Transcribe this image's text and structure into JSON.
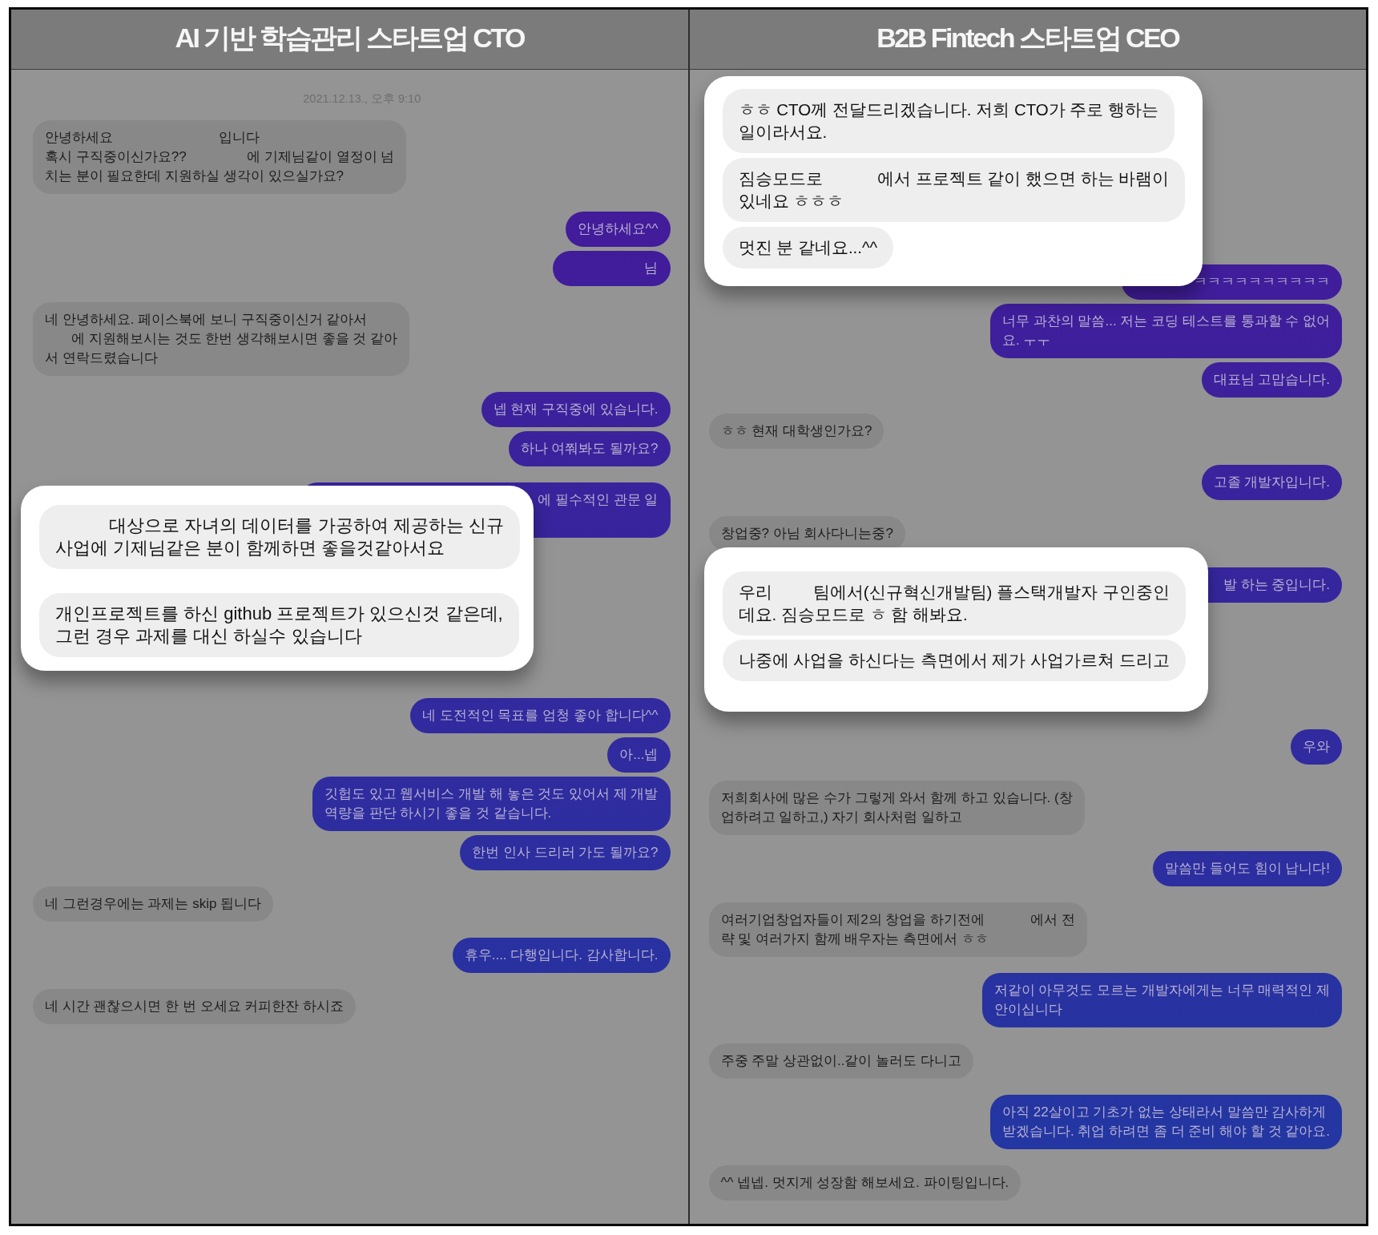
{
  "panels": [
    {
      "title": "AI 기반 학습관리 스타트업 CTO",
      "chat": [
        {
          "kind": "timestamp",
          "text": "2021.12.13., 오후 9:10"
        },
        {
          "kind": "received",
          "text": "안녕하세요                            입니다\n혹시 구직중이신가요??                에 기제님같이 열정이 넘\n치는 분이 필요한데 지원하실 생각이 있으실가요?"
        },
        {
          "kind": "sent",
          "text": "안녕하세요^^"
        },
        {
          "kind": "sent",
          "text": "                     님"
        },
        {
          "kind": "received",
          "text": "네 안녕하세요. 페이스북에 보니 구직중이신거 같아서\n       에 지원해보시는 것도 한번 생각해보시면 좋을 것 같아\n서 연락드렸습니다"
        },
        {
          "kind": "sent",
          "text": "넵 현재 구직중에 있습니다."
        },
        {
          "kind": "sent",
          "text": "하나 여쭤봐도 될까요?"
        },
        {
          "kind": "sent",
          "text": "에 필수적인 관문 일"
        },
        {
          "kind": "highlight",
          "messages": [
            {
              "text": "           대상으로 자녀의 데이터를 가공하여 제공하는 신규\n사업에 기제님같은 분이 함께하면 좋을것같아서요"
            },
            {
              "text": "개인프로젝트를 하신 github 프로젝트가 있으신것 같은데,\n그런 경우 과제를 대신 하실수 있습니다"
            }
          ]
        },
        {
          "kind": "sent",
          "text": "네 도전적인 목표를 엄청 좋아 합니다^^"
        },
        {
          "kind": "sent",
          "text": "아...넵"
        },
        {
          "kind": "sent",
          "text": "깃헙도 있고 웹서비스 개발 해 놓은 것도 있어서 제 개발\n역량을 판단 하시기 좋을 것 같습니다."
        },
        {
          "kind": "sent",
          "text": "한번 인사 드리러 가도 될까요?"
        },
        {
          "kind": "received",
          "text": "네 그런경우에는 과제는 skip 됩니다"
        },
        {
          "kind": "sent",
          "text": "휴우.... 다행입니다. 감사합니다."
        },
        {
          "kind": "received",
          "text": "네 시간 괜찮으시면 한 번 오세요 커피한잔 하시죠"
        }
      ]
    },
    {
      "title": "B2B Fintech 스타트업 CEO",
      "chat": [
        {
          "kind": "highlight",
          "messages": [
            {
              "text": "ㅎㅎ CTO께 전달드리겠습니다. 저희 CTO가 주로 행하는\n일이라서요."
            },
            {
              "text": "짐승모드로            에서 프로젝트 같이 했으면 하는 바램이\n있네요 ㅎㅎㅎ"
            },
            {
              "text": "멋진 분 같네요...^^"
            }
          ]
        },
        {
          "kind": "sent",
          "text": "ㅋㅋㅋㅋㅋㅋㅋㅋㅋㅋ"
        },
        {
          "kind": "sent",
          "text": "너무 과찬의 말씀... 저는 코딩 테스트를 통과할 수 없어\n요. ㅜㅜ"
        },
        {
          "kind": "sent",
          "text": "대표님 고맙습니다."
        },
        {
          "kind": "received",
          "text": "ㅎㅎ 현재 대학생인가요?"
        },
        {
          "kind": "sent",
          "text": "고졸 개발자입니다."
        },
        {
          "kind": "received",
          "text": "창업중? 아님 회사다니는중?"
        },
        {
          "kind": "sent",
          "text": "발 하는 중입니다."
        },
        {
          "kind": "highlight",
          "messages": [
            {
              "text": "우리         팀에서(신규혁신개발팀) 플스택개발자 구인중인\n데요. 짐승모드로 ㅎ 함 해봐요."
            },
            {
              "text": "나중에 사업을 하신다는 측면에서 제가 사업가르쳐 드리고"
            }
          ]
        },
        {
          "kind": "sent",
          "text": "우와"
        },
        {
          "kind": "received",
          "text": "저희회사에 많은 수가 그렇게 와서 함께 하고 있습니다. (창\n업하려고 일하고,) 자기 회사처럼 일하고"
        },
        {
          "kind": "sent",
          "text": "말씀만 들어도 힘이 납니다!"
        },
        {
          "kind": "received",
          "text": "여러기업창업자들이 제2의 창업을 하기전에            에서 전\n략 및 여러가지 함께 배우자는 측면에서 ㅎㅎ"
        },
        {
          "kind": "sent",
          "text": "저같이 아무것도 모르는 개발자에게는 너무 매력적인 제\n안이십니다"
        },
        {
          "kind": "received",
          "text": "주중 주말 상관없이..같이 놀러도 다니고"
        },
        {
          "kind": "sent",
          "text": "아직 22살이고 기초가 없는 상태라서 말씀만 감사하게\n받겠습니다. 취업 하려면 좀 더 준비 해야 할 것 같아요."
        },
        {
          "kind": "received",
          "text": "^^ 넵넵. 멋지게 성장함 해보세요. 파이팅입니다."
        }
      ]
    }
  ]
}
